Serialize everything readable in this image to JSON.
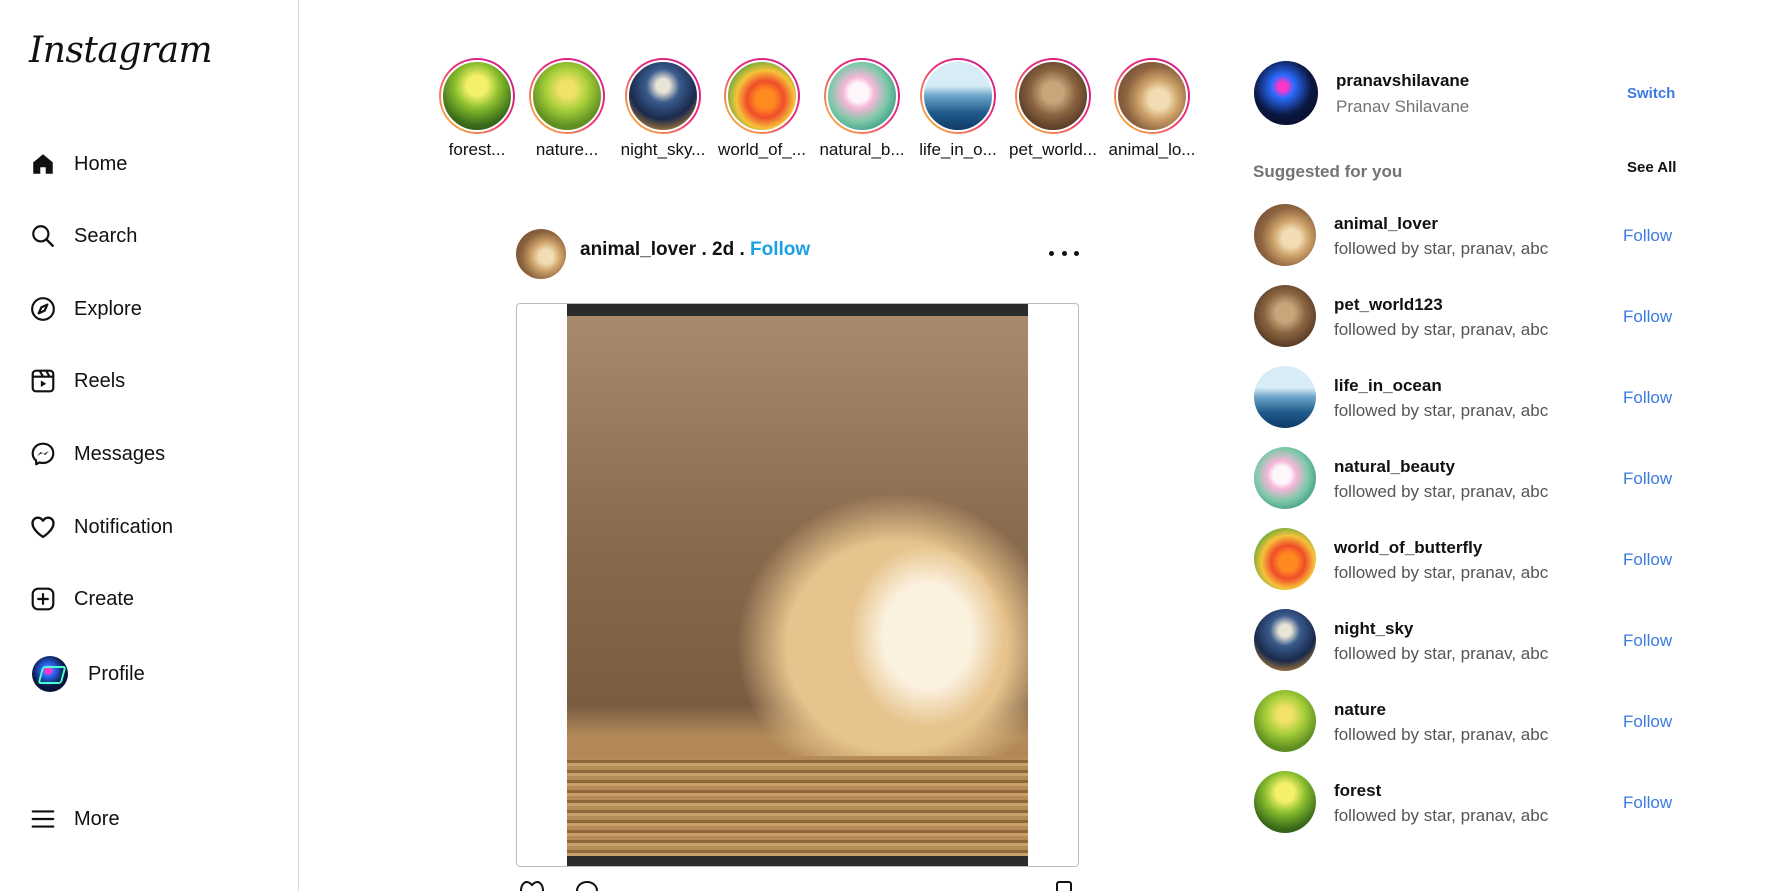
{
  "app": {
    "logo": "Instagram"
  },
  "sidebar": {
    "items": [
      {
        "label": "Home",
        "icon": "home-icon"
      },
      {
        "label": "Search",
        "icon": "search-icon"
      },
      {
        "label": "Explore",
        "icon": "compass-icon"
      },
      {
        "label": "Reels",
        "icon": "reels-icon"
      },
      {
        "label": "Messages",
        "icon": "messenger-icon"
      },
      {
        "label": "Notification",
        "icon": "heart-icon"
      },
      {
        "label": "Create",
        "icon": "plus-square-icon"
      },
      {
        "label": "Profile",
        "icon": "avatar"
      }
    ],
    "more_label": "More"
  },
  "stories": [
    {
      "name": "forest..."
    },
    {
      "name": "nature..."
    },
    {
      "name": "night_sky..."
    },
    {
      "name": "world_of_..."
    },
    {
      "name": "natural_b..."
    },
    {
      "name": "life_in_o..."
    },
    {
      "name": "pet_world..."
    },
    {
      "name": "animal_lo..."
    }
  ],
  "post": {
    "username": "animal_lover",
    "time": " . 2d . ",
    "follow_label": "Follow"
  },
  "account": {
    "username": "pranavshilavane",
    "full_name": "Pranav Shilavane",
    "switch_label": "Switch"
  },
  "suggestions": {
    "title": "Suggested for you",
    "see_all": "See All",
    "items": [
      {
        "username": "animal_lover",
        "subtitle": "followed by star, pranav, abc",
        "action": "Follow"
      },
      {
        "username": "pet_world123",
        "subtitle": "followed by star, pranav, abc",
        "action": "Follow"
      },
      {
        "username": "life_in_ocean",
        "subtitle": "followed by star, pranav, abc",
        "action": "Follow"
      },
      {
        "username": "natural_beauty",
        "subtitle": "followed by star, pranav, abc",
        "action": "Follow"
      },
      {
        "username": "world_of_butterfly",
        "subtitle": "followed by star, pranav, abc",
        "action": "Follow"
      },
      {
        "username": "night_sky",
        "subtitle": "followed by star, pranav, abc",
        "action": "Follow"
      },
      {
        "username": "nature",
        "subtitle": "followed by star, pranav, abc",
        "action": "Follow"
      },
      {
        "username": "forest",
        "subtitle": "followed by star, pranav, abc",
        "action": "Follow"
      }
    ]
  },
  "colors": {
    "link": "#3b7ae0",
    "post_follow": "#1da1e6",
    "muted": "#737373"
  }
}
